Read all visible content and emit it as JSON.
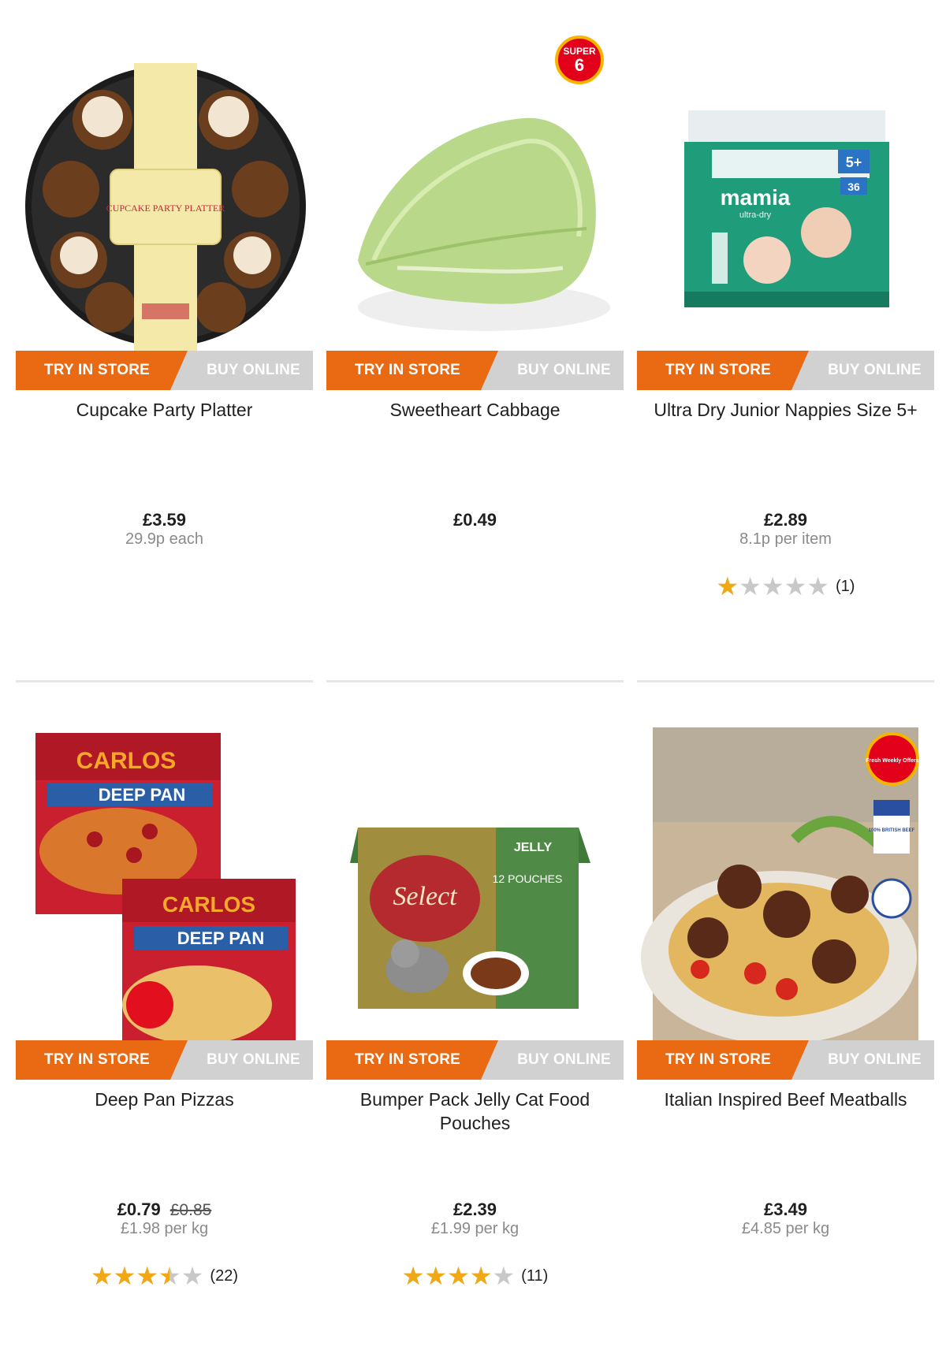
{
  "tabs": {
    "store_label": "TRY IN STORE",
    "online_label": "BUY ONLINE"
  },
  "badges": {
    "super6_top": "SUPER",
    "super6_num": "6",
    "fresh": "Fresh Weekly Offers",
    "british": "100% BRITISH BEEF"
  },
  "products": [
    {
      "name": "Cupcake Party Platter",
      "price": "£3.59",
      "unit": "29.9p each",
      "packaging_text": "CUPCAKE PARTY PLATTER"
    },
    {
      "name": "Sweetheart Cabbage",
      "price": "£0.49"
    },
    {
      "name": "Ultra Dry Junior Nappies Size 5+",
      "price": "£2.89",
      "unit": "8.1p per item",
      "rating": 1,
      "reviews": "(1)",
      "packaging_text": "mamia",
      "packaging_sub": "ultra-dry",
      "packaging_size": "5+",
      "packaging_count": "36"
    },
    {
      "name": "Deep Pan Pizzas",
      "price": "£0.79",
      "was": "£0.85",
      "unit": "£1.98 per kg",
      "rating": 3.5,
      "reviews": "(22)",
      "packaging_text": "CARLOS",
      "packaging_sub": "DEEP PAN"
    },
    {
      "name": "Bumper Pack Jelly Cat Food Pouches",
      "price": "£2.39",
      "unit": "£1.99 per kg",
      "rating": 4,
      "reviews": "(11)",
      "packaging_text": "Select",
      "packaging_sub": "JELLY",
      "packaging_count": "12 POUCHES"
    },
    {
      "name": "Italian Inspired Beef Meatballs",
      "price": "£3.49",
      "unit": "£4.85 per kg"
    }
  ],
  "colors": {
    "accent": "#ea6a14",
    "tab_grey": "#d1d1d1",
    "star_fill": "#f0a815",
    "star_empty": "#c8c8c8"
  }
}
